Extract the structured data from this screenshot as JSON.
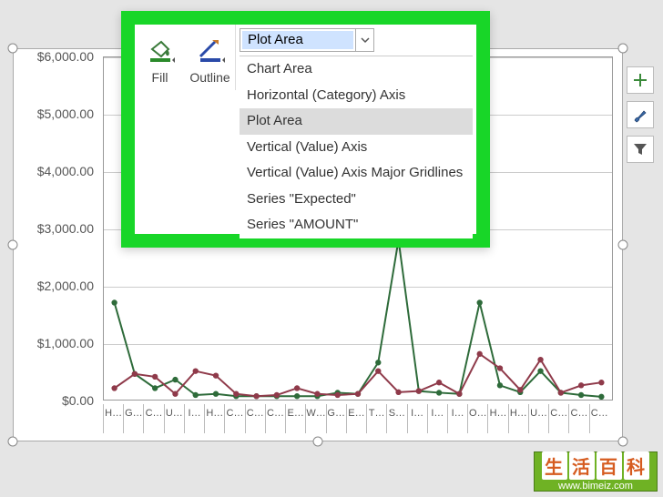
{
  "toolbar": {
    "fill_label": "Fill",
    "outline_label": "Outline",
    "combo_value": "Plot Area",
    "dropdown": [
      "Chart Area",
      "Horizontal (Category) Axis",
      "Plot Area",
      "Vertical (Value) Axis",
      "Vertical (Value) Axis Major Gridlines",
      "Series \"Expected\"",
      "Series \"AMOUNT\""
    ],
    "selected_index": 2
  },
  "yaxis": {
    "ticks": [
      "$6,000.00",
      "$5,000.00",
      "$4,000.00",
      "$3,000.00",
      "$2,000.00",
      "$1,000.00",
      "$0.00"
    ]
  },
  "xaxis": {
    "ticks": [
      "H…",
      "G…",
      "C…",
      "U…",
      "I…",
      "H…",
      "C…",
      "C…",
      "C…",
      "E…",
      "W…",
      "G…",
      "E…",
      "T…",
      "S…",
      "I…",
      "I…",
      "I…",
      "O…",
      "H…",
      "H…",
      "U…",
      "C…",
      "C…",
      "C…"
    ]
  },
  "side_buttons": {
    "plus_tip": "Chart Elements",
    "brush_tip": "Chart Styles",
    "filter_tip": "Chart Filters"
  },
  "watermark": {
    "chars": "生活百科",
    "url": "www.bimeiz.com"
  },
  "chart_data": {
    "type": "line",
    "ylim": [
      0,
      6000
    ],
    "ylabel": "$",
    "xlabel": "",
    "categories": [
      "H",
      "G",
      "C",
      "U",
      "I",
      "H",
      "C",
      "C",
      "C",
      "E",
      "W",
      "G",
      "E",
      "T",
      "S",
      "I",
      "I",
      "I",
      "O",
      "H",
      "H",
      "U",
      "C",
      "C",
      "C"
    ],
    "series": [
      {
        "name": "Expected",
        "color": "#2e6b3a",
        "values": [
          1700,
          450,
          200,
          350,
          80,
          100,
          60,
          60,
          60,
          60,
          60,
          120,
          100,
          650,
          2800,
          150,
          120,
          100,
          1700,
          250,
          130,
          500,
          120,
          80,
          50
        ]
      },
      {
        "name": "AMOUNT",
        "color": "#8f3a4a",
        "values": [
          200,
          450,
          400,
          100,
          500,
          420,
          100,
          60,
          80,
          200,
          100,
          80,
          100,
          500,
          130,
          150,
          300,
          100,
          800,
          550,
          170,
          700,
          120,
          250,
          300
        ]
      }
    ]
  }
}
